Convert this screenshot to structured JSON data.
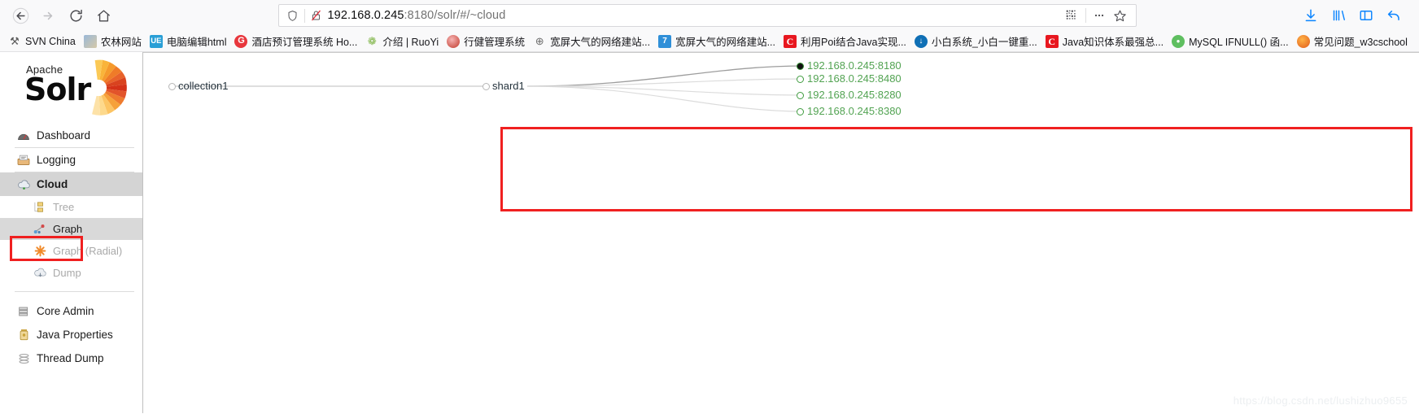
{
  "browser": {
    "nav": {
      "back": "back-arrow",
      "forward": "forward-arrow",
      "reload": "reload-arrow",
      "home": "home-house"
    },
    "urlbar": {
      "url_host": "192.168.0.245",
      "url_rest": ":8180/solr/#/~cloud",
      "full_url": "192.168.0.245:8180/solr/#/~cloud",
      "shield_icon": "tracking-protection-shield",
      "lock_icon": "lock-slashed-insecure",
      "qr_icon": "qr-code-icon",
      "more_icon": "page-actions-ellipsis",
      "bookmark_icon": "bookmark-star-icon"
    },
    "toolbar_right": {
      "downloads": "download-arrow-icon",
      "library": "library-books-icon",
      "sidebar": "sidebar-panel-icon",
      "sync": "undo-back-icon"
    }
  },
  "bookmarks": [
    {
      "label": "SVN China",
      "icon": "svn-icon",
      "icon_class": "ic-svn",
      "glyph": "⚒"
    },
    {
      "label": "农林网站",
      "icon": "forestry-icon",
      "icon_class": "ic-farm",
      "glyph": ""
    },
    {
      "label": "电脑编辑html",
      "icon": "ue-editor-icon",
      "icon_class": "ic-ue",
      "glyph": "UE"
    },
    {
      "label": "酒店预订管理系统 Ho...",
      "icon": "hotel-g-icon",
      "icon_class": "ic-g",
      "glyph": "G"
    },
    {
      "label": "介绍 | RuoYi",
      "icon": "ruoyi-leaf-icon",
      "icon_class": "ic-leaf",
      "glyph": "❁"
    },
    {
      "label": "行健管理系统",
      "icon": "xingjian-icon",
      "icon_class": "ic-xj",
      "glyph": ""
    },
    {
      "label": "宽屏大气的网络建站...",
      "icon": "globe-icon",
      "icon_class": "ic-globe",
      "glyph": "⊕"
    },
    {
      "label": "宽屏大气的网络建站...",
      "icon": "site-blue-icon",
      "icon_class": "ic-blue",
      "glyph": "7"
    },
    {
      "label": "利用Poi结合Java实现...",
      "icon": "csdn-c-icon",
      "icon_class": "ic-c",
      "glyph": "C"
    },
    {
      "label": "小白系统_小白一键重...",
      "icon": "xiaobai-icon",
      "icon_class": "ic-down",
      "glyph": "↓"
    },
    {
      "label": "Java知识体系最强总...",
      "icon": "csdn-c-icon",
      "icon_class": "ic-c",
      "glyph": "C"
    },
    {
      "label": "MySQL IFNULL() 函...",
      "icon": "mysql-icon",
      "icon_class": "ic-mysql",
      "glyph": "●"
    },
    {
      "label": "常见问题_w3cschool",
      "icon": "w3cschool-icon",
      "icon_class": "ic-w3c",
      "glyph": ""
    }
  ],
  "solr": {
    "logo_apache": "Apache",
    "logo_name": "Solr",
    "nav": [
      {
        "label": "Dashboard",
        "icon": "dashboard-gauge-icon",
        "state": "normal",
        "level": "top"
      },
      {
        "label": "Logging",
        "icon": "logging-tray-icon",
        "state": "normal",
        "level": "top"
      },
      {
        "label": "Cloud",
        "icon": "cloud-icon",
        "state": "active",
        "level": "top"
      },
      {
        "label": "Tree",
        "icon": "tree-node-icon",
        "state": "dim",
        "level": "sub"
      },
      {
        "label": "Graph",
        "icon": "graph-nodes-icon",
        "state": "sel",
        "level": "sub"
      },
      {
        "label": "Graph (Radial)",
        "icon": "radial-asterisk-icon",
        "state": "dim",
        "level": "sub"
      },
      {
        "label": "Dump",
        "icon": "dump-cloud-icon",
        "state": "dim",
        "level": "sub"
      },
      {
        "label": "Core Admin",
        "icon": "core-admin-db-icon",
        "state": "normal",
        "level": "top"
      },
      {
        "label": "Java Properties",
        "icon": "java-properties-icon",
        "state": "normal",
        "level": "top"
      },
      {
        "label": "Thread Dump",
        "icon": "thread-dump-icon",
        "state": "normal",
        "level": "top"
      }
    ]
  },
  "graph": {
    "collection": {
      "label": "collection1",
      "marker": "hollow-gray"
    },
    "shard": {
      "label": "shard1",
      "marker": "hollow-gray"
    },
    "replicas": [
      {
        "label": "192.168.0.245:8180",
        "marker": "filled-leader",
        "color": "#52a352"
      },
      {
        "label": "192.168.0.245:8480",
        "marker": "hollow-green",
        "color": "#52a352"
      },
      {
        "label": "192.168.0.245:8280",
        "marker": "hollow-green",
        "color": "#52a352"
      },
      {
        "label": "192.168.0.245:8380",
        "marker": "hollow-green",
        "color": "#52a352"
      }
    ],
    "highlight_color": "#f02020"
  },
  "watermark": {
    "text": "https://blog.csdn.net/lushizhuo9655"
  }
}
